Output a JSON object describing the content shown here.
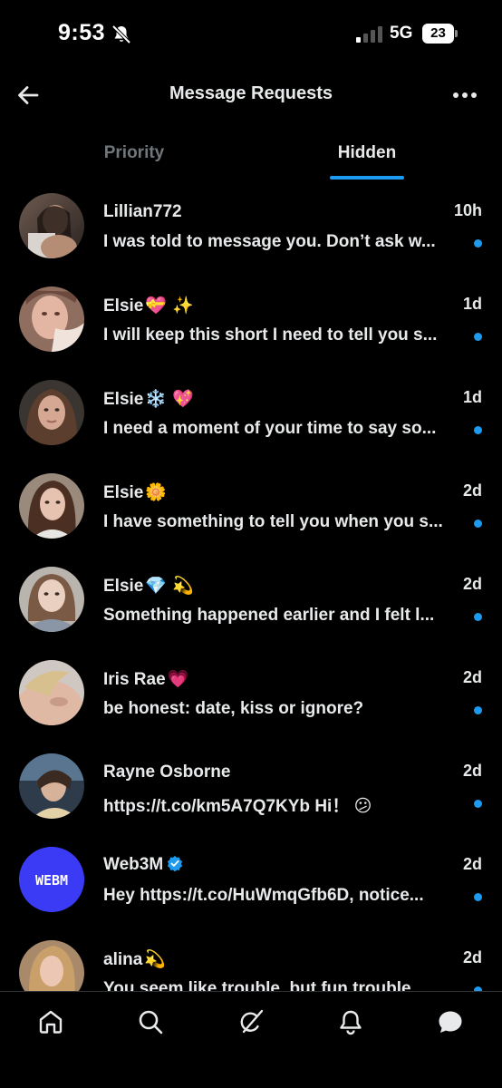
{
  "status_bar": {
    "time": "9:53",
    "network": "5G",
    "battery": "23"
  },
  "header": {
    "title": "Message Requests",
    "back_icon": "back-arrow-icon",
    "more_icon": "more-horizontal-icon"
  },
  "tabs": [
    {
      "label": "Priority",
      "active": false
    },
    {
      "label": "Hidden",
      "active": true
    }
  ],
  "conversations": [
    {
      "name": "Lillian772",
      "emoji": "",
      "time": "10h",
      "preview": "I was told to message you. Don’t ask w...",
      "unread": true,
      "verified": false
    },
    {
      "name": "Elsie",
      "emoji": "💝 ✨",
      "time": "1d",
      "preview": "I will keep this short I need to tell you s...",
      "unread": true,
      "verified": false
    },
    {
      "name": "Elsie",
      "emoji": "❄️ 💖",
      "time": "1d",
      "preview": "I need a moment of your time to say so...",
      "unread": true,
      "verified": false
    },
    {
      "name": "Elsie",
      "emoji": "🌼",
      "time": "2d",
      "preview": "I have something to tell you when you s...",
      "unread": true,
      "verified": false
    },
    {
      "name": "Elsie",
      "emoji": "💎 💫",
      "time": "2d",
      "preview": "Something happened earlier and I felt l...",
      "unread": true,
      "verified": false
    },
    {
      "name": "Iris Rae",
      "emoji": "💗",
      "time": "2d",
      "preview": "be honest: date, kiss or ignore?",
      "unread": true,
      "verified": false
    },
    {
      "name": "Rayne Osborne",
      "emoji": "",
      "time": "2d",
      "preview": "https://t.co/km5A7Q7KYb Hi！ 😕",
      "unread": true,
      "verified": false
    },
    {
      "name": "Web3M",
      "emoji": "",
      "time": "2d",
      "preview": "Hey https://t.co/HuWmqGfb6D, notice...",
      "unread": true,
      "verified": true,
      "avatar_text": "WEBM"
    },
    {
      "name": "alina",
      "emoji": "💫",
      "time": "2d",
      "preview": "You seem like trouble, but fun trouble...",
      "unread": true,
      "verified": false
    }
  ],
  "bottom_nav": [
    {
      "icon": "home-icon"
    },
    {
      "icon": "search-icon"
    },
    {
      "icon": "grok-icon"
    },
    {
      "icon": "notifications-bell-icon"
    },
    {
      "icon": "messages-icon"
    }
  ],
  "colors": {
    "background": "#000000",
    "text": "#e7e9ea",
    "muted": "#71767b",
    "accent": "#1d9bf0",
    "web3m_avatar": "#3b3bf5"
  }
}
